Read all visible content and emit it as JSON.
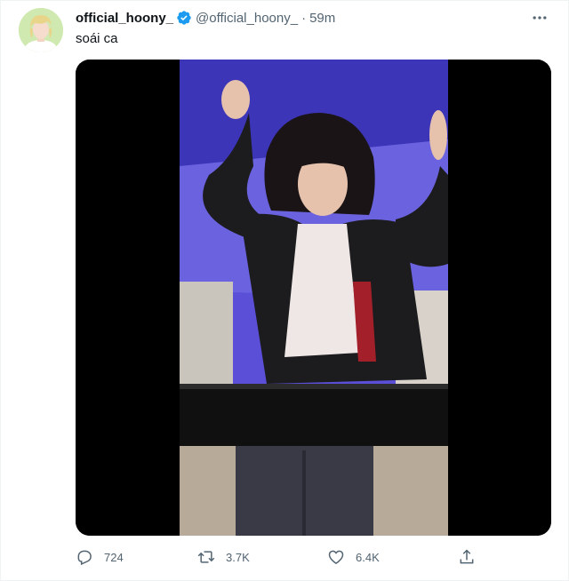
{
  "tweet": {
    "display_name": "official_hoony_",
    "handle": "@official_hoony_",
    "separator": "·",
    "time": "59m",
    "text": "soái ca",
    "verified": true,
    "accent_color": "#1d9bf0"
  },
  "media": {
    "type": "video",
    "description_icon": "video-frame"
  },
  "actions": {
    "reply_count": "724",
    "retweet_count": "3.7K",
    "like_count": "6.4K"
  },
  "icons": {
    "more": "more-icon",
    "reply": "reply-icon",
    "retweet": "retweet-icon",
    "like": "heart-icon",
    "share": "share-icon",
    "verified": "verified-badge-icon"
  }
}
